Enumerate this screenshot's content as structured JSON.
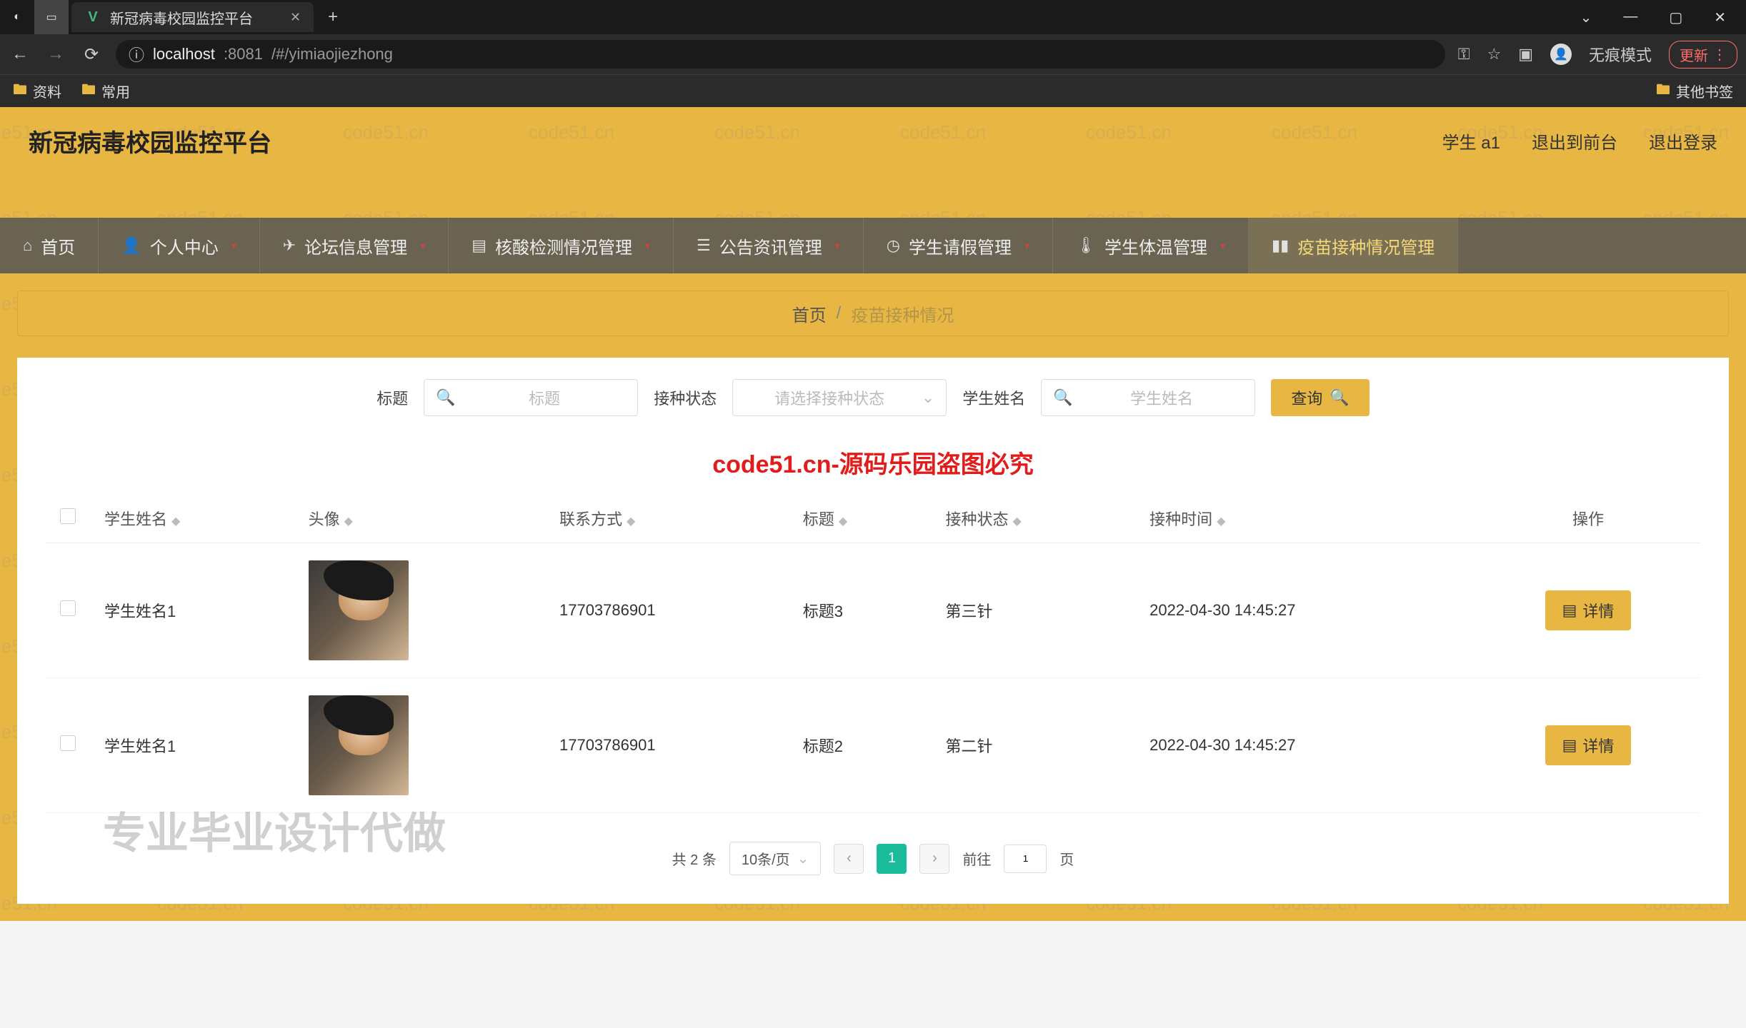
{
  "browser": {
    "tab_title": "新冠病毒校园监控平台",
    "url_host": "localhost",
    "url_port": ":8081",
    "url_path": "/#/yimiaojiezhong",
    "bookmarks": [
      "资料",
      "常用"
    ],
    "other_bookmarks": "其他书签",
    "incognito_label": "无痕模式",
    "update_label": "更新"
  },
  "header": {
    "title": "新冠病毒校园监控平台",
    "user": "学生 a1",
    "exit_front": "退出到前台",
    "logout": "退出登录"
  },
  "nav": {
    "items": [
      {
        "label": "首页",
        "icon": "home"
      },
      {
        "label": "个人中心",
        "icon": "user",
        "caret": true
      },
      {
        "label": "论坛信息管理",
        "icon": "send",
        "caret": true
      },
      {
        "label": "核酸检测情况管理",
        "icon": "doc",
        "caret": true
      },
      {
        "label": "公告资讯管理",
        "icon": "list",
        "caret": true
      },
      {
        "label": "学生请假管理",
        "icon": "clock",
        "caret": true
      },
      {
        "label": "学生体温管理",
        "icon": "thermo",
        "caret": true
      },
      {
        "label": "疫苗接种情况管理",
        "icon": "bar",
        "active": true
      }
    ]
  },
  "breadcrumb": {
    "home": "首页",
    "current": "疫苗接种情况"
  },
  "search": {
    "title_label": "标题",
    "title_placeholder": "标题",
    "status_label": "接种状态",
    "status_placeholder": "请选择接种状态",
    "name_label": "学生姓名",
    "name_placeholder": "学生姓名",
    "query_btn": "查询"
  },
  "watermarks": {
    "repeat": "code51.cn",
    "center_red": "code51.cn-源码乐园盗图必究",
    "big_gray": "专业毕业设计代做"
  },
  "table": {
    "columns": [
      "学生姓名",
      "头像",
      "联系方式",
      "标题",
      "接种状态",
      "接种时间",
      "操作"
    ],
    "detail_btn": "详情",
    "rows": [
      {
        "name": "学生姓名1",
        "phone": "17703786901",
        "title": "标题3",
        "status": "第三针",
        "time": "2022-04-30 14:45:27"
      },
      {
        "name": "学生姓名1",
        "phone": "17703786901",
        "title": "标题2",
        "status": "第二针",
        "time": "2022-04-30 14:45:27"
      }
    ]
  },
  "pagination": {
    "total_text": "共 2 条",
    "page_size": "10条/页",
    "current": "1",
    "goto_label": "前往",
    "goto_value": "1",
    "page_suffix": "页"
  }
}
